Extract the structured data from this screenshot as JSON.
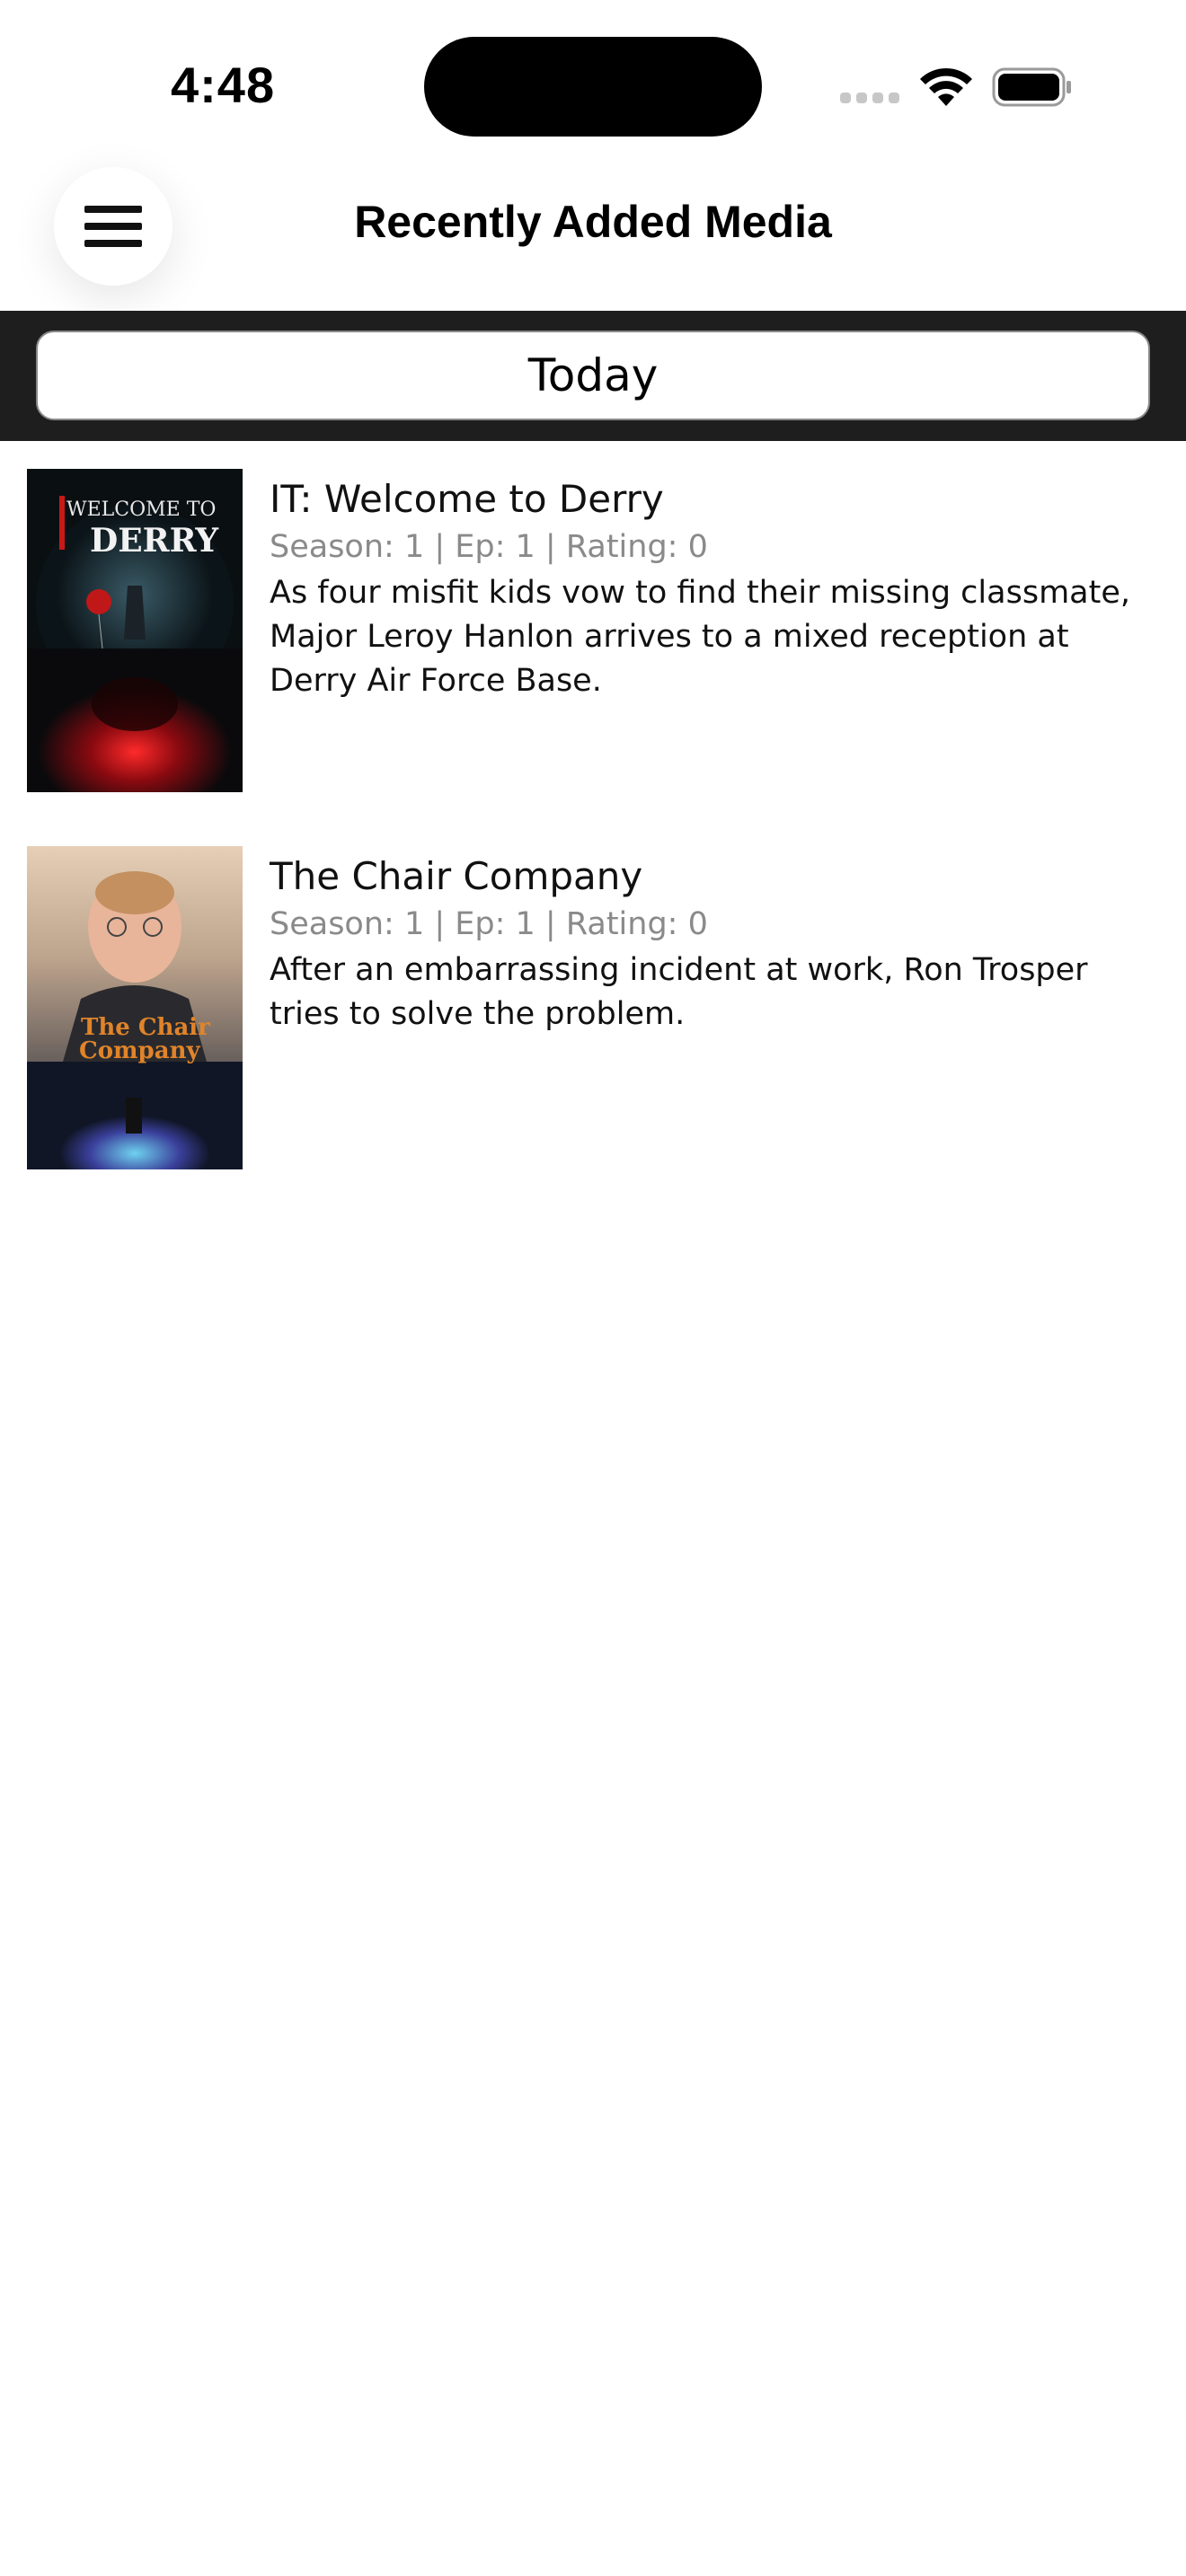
{
  "status_bar": {
    "time": "4:48"
  },
  "header": {
    "title": "Recently Added Media",
    "menu_icon": "hamburger-menu-icon"
  },
  "segment": {
    "selected_label": "Today"
  },
  "media": [
    {
      "title": "IT: Welcome to Derry",
      "meta": "Season: 1 | Ep: 1 | Rating: 0",
      "description": "As four misfit kids vow to find their missing classmate, Major Leroy Hanlon arrives to a mixed reception at Derry Air Force Base.",
      "poster_text_1": "WELCOME TO",
      "poster_text_2": "DERRY"
    },
    {
      "title": "The Chair Company",
      "meta": "Season: 1 | Ep: 1 | Rating: 0",
      "description": "After an embarrassing incident at work, Ron Trosper tries to solve the problem.",
      "poster_text_1": "The Chair",
      "poster_text_2": "Company"
    }
  ],
  "colors": {
    "segment_bar_bg": "#1e1e1e",
    "meta_text": "#8a8a8a"
  }
}
